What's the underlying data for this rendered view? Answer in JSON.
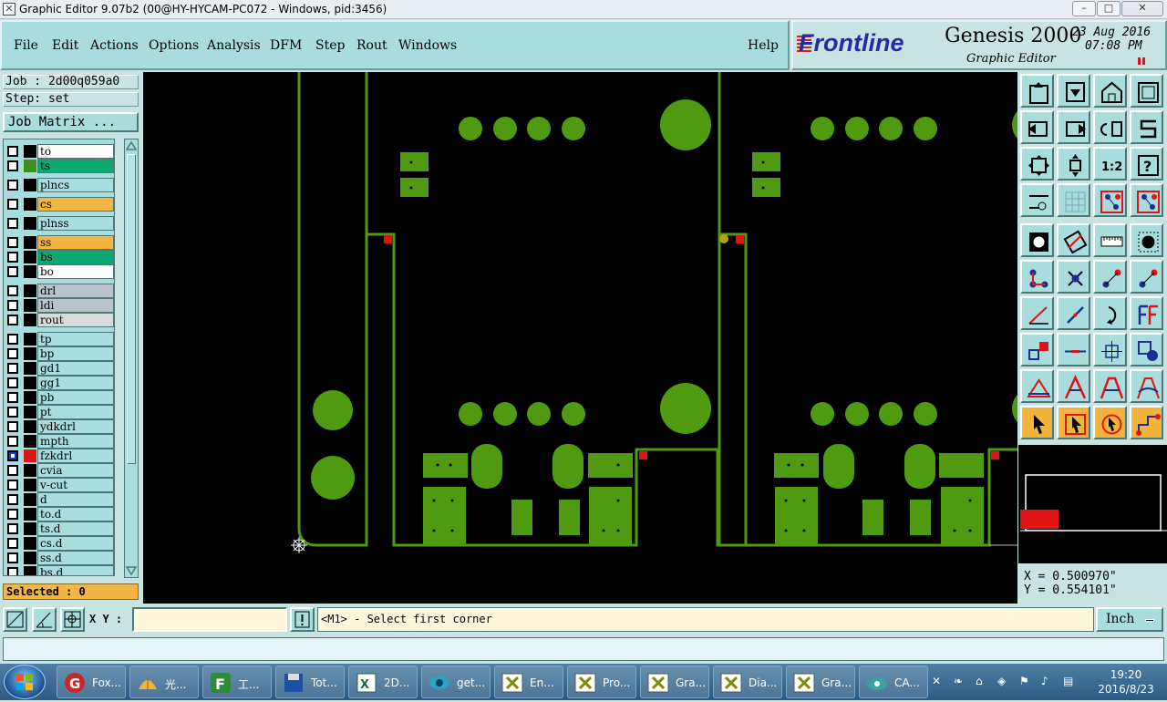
{
  "window": {
    "title": "Graphic Editor 9.07b2 (00@HY-HYCAM-PC072 - Windows, pid:3456)",
    "controls": [
      "–",
      "□",
      "✕"
    ]
  },
  "menu": {
    "items": [
      "File",
      "Edit",
      "Actions",
      "Options",
      "Analysis",
      "DFM",
      "Step",
      "Rout",
      "Windows"
    ],
    "help": "Help"
  },
  "brand": {
    "logo": "Frontline",
    "product": "Genesis 2000",
    "subtitle": "Graphic Editor",
    "date": "23 Aug 2016",
    "time": "07:08 PM"
  },
  "job": {
    "job_line": "Job : 2d00q059a0",
    "step_line": "Step: set",
    "matrix_button": "Job Matrix ..."
  },
  "layers": [
    {
      "name": "to",
      "color": "#ffffff",
      "chip": "#000000"
    },
    {
      "name": "ts",
      "color": "#0ba86f",
      "chip": "#3a8f1f"
    },
    {
      "name": "plncs",
      "color": "#a9dcdc",
      "chip": "#000000"
    },
    {
      "name": "cs",
      "color": "#f4b642",
      "chip": "#000000"
    },
    {
      "name": "plnss",
      "color": "#a9dcdc",
      "chip": "#000000"
    },
    {
      "name": "ss",
      "color": "#f4b642",
      "chip": "#000000"
    },
    {
      "name": "bs",
      "color": "#0ba86f",
      "chip": "#000000"
    },
    {
      "name": "bo",
      "color": "#ffffff",
      "chip": "#000000"
    },
    {
      "name": "drl",
      "color": "#b8c4c8",
      "chip": "#000000"
    },
    {
      "name": "ldi",
      "color": "#b8c4c8",
      "chip": "#000000"
    },
    {
      "name": "rout",
      "color": "#d8dcdc",
      "chip": "#000000"
    },
    {
      "name": "tp",
      "color": "#a9dcdc",
      "chip": "#000000"
    },
    {
      "name": "bp",
      "color": "#a9dcdc",
      "chip": "#000000"
    },
    {
      "name": "gd1",
      "color": "#a9dcdc",
      "chip": "#000000"
    },
    {
      "name": "gg1",
      "color": "#a9dcdc",
      "chip": "#000000"
    },
    {
      "name": "pb",
      "color": "#a9dcdc",
      "chip": "#000000"
    },
    {
      "name": "pt",
      "color": "#a9dcdc",
      "chip": "#000000"
    },
    {
      "name": "ydkdrl",
      "color": "#a9dcdc",
      "chip": "#000000"
    },
    {
      "name": "mpth",
      "color": "#a9dcdc",
      "chip": "#000000"
    },
    {
      "name": "fzkdrl",
      "color": "#a9dcdc",
      "chip": "#e01414"
    },
    {
      "name": "cvia",
      "color": "#a9dcdc",
      "chip": "#000000"
    },
    {
      "name": "v-cut",
      "color": "#a9dcdc",
      "chip": "#000000"
    },
    {
      "name": "d",
      "color": "#a9dcdc",
      "chip": "#000000"
    },
    {
      "name": "to.d",
      "color": "#a9dcdc",
      "chip": "#000000"
    },
    {
      "name": "ts.d",
      "color": "#a9dcdc",
      "chip": "#000000"
    },
    {
      "name": "cs.d",
      "color": "#a9dcdc",
      "chip": "#000000"
    },
    {
      "name": "ss.d",
      "color": "#a9dcdc",
      "chip": "#000000"
    },
    {
      "name": "bs.d",
      "color": "#a9dcdc",
      "chip": "#000000"
    }
  ],
  "selected": "Selected : 0",
  "coords": {
    "x": "X = 0.500970\"",
    "y": "Y = 0.554101\""
  },
  "status": {
    "xy_label": "X Y :",
    "xy_value": "",
    "prompt": "<M1> - Select first corner",
    "unit": "Inch"
  },
  "colors": {
    "board_green": "#4f9a10",
    "accent_red": "#e01414",
    "panel": "#a9dcdc",
    "highlight_yellow": "#f2b43b"
  },
  "toolbox": {
    "rows": [
      [
        "open-icon",
        "save-icon",
        "home-icon",
        "window-icon"
      ],
      [
        "prev-step-icon",
        "next-step-icon",
        "redo-icon",
        "snap-s-icon"
      ],
      [
        "zoom-fit-icon",
        "zoom-home-icon",
        "ratio-icon",
        "query-icon"
      ],
      [
        "measure-icon",
        "grid-icon",
        "layer-toggle-icon",
        "layer-toggle-2-icon"
      ],
      [
        "pad-icon",
        "shape-icon",
        "ruler-icon",
        "circle-fill-icon"
      ],
      [
        "nodes-icon",
        "cross-icon",
        "point-icon",
        "point-2-icon"
      ],
      [
        "line-icon",
        "line-2-icon",
        "arc-icon",
        "ff-icon"
      ],
      [
        "move-icon",
        "minus-icon",
        "stretch-icon",
        "transform-icon"
      ],
      [
        "triangle-icon",
        "triangle-2-icon",
        "triangle-3-icon",
        "triangle-4-icon"
      ],
      [
        "pointer-icon",
        "pointer-2-icon",
        "pointer-3-icon",
        "path-icon"
      ]
    ]
  },
  "taskbar": {
    "tasks": [
      {
        "label": "Fox...",
        "icon": "foxit-icon"
      },
      {
        "label": "光...",
        "icon": "shell-icon"
      },
      {
        "label": "工...",
        "icon": "frontline-app-icon"
      },
      {
        "label": "Tot...",
        "icon": "floppy-icon"
      },
      {
        "label": "2D...",
        "icon": "excel-icon"
      },
      {
        "label": "get...",
        "icon": "eye-icon"
      },
      {
        "label": "En...",
        "icon": "genesis-icon"
      },
      {
        "label": "Pro...",
        "icon": "genesis-icon"
      },
      {
        "label": "Gra...",
        "icon": "genesis-icon"
      },
      {
        "label": "Dia...",
        "icon": "genesis-icon"
      },
      {
        "label": "Gra...",
        "icon": "genesis-icon"
      },
      {
        "label": "CA...",
        "icon": "cam-icon"
      }
    ],
    "clock_time": "19:20",
    "clock_date": "2016/8/23"
  }
}
